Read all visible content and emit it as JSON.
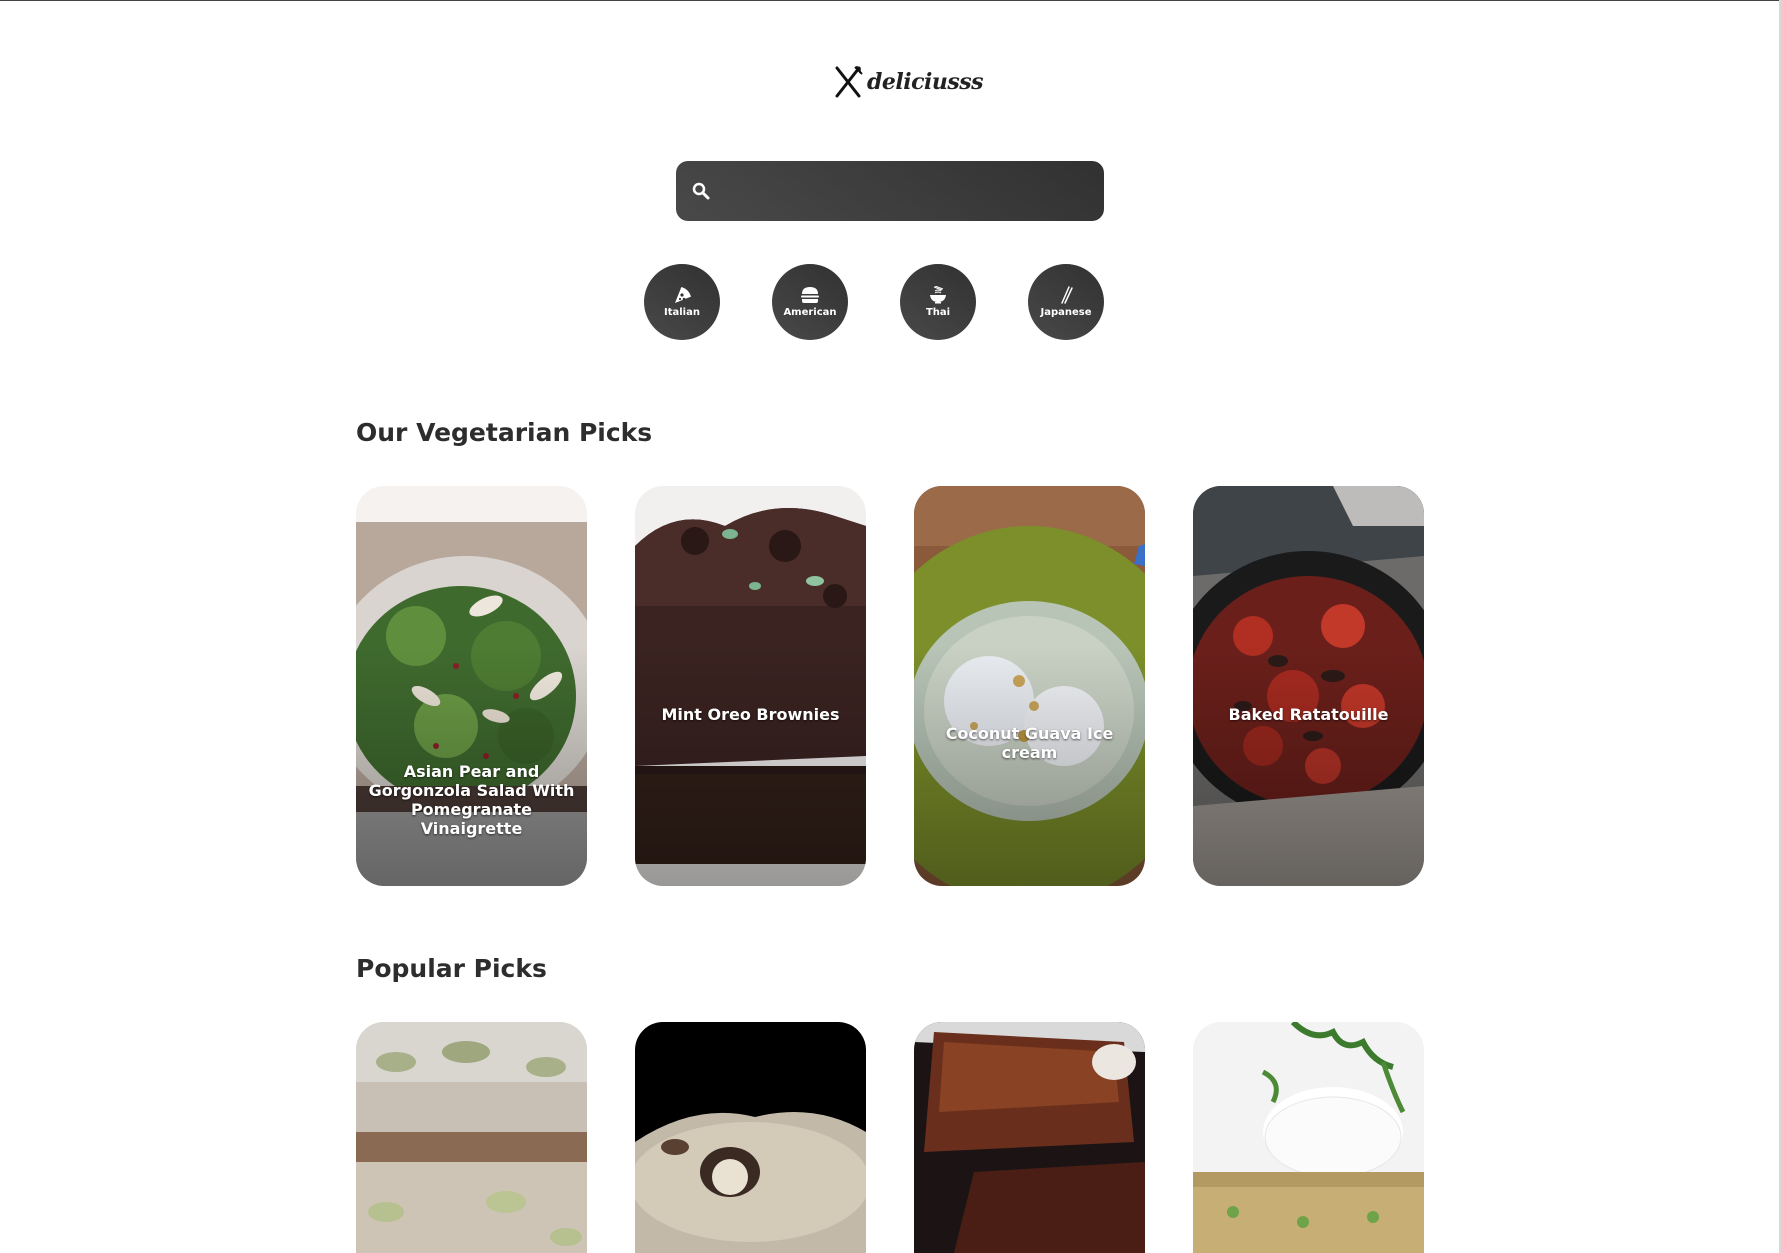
{
  "brand": {
    "name": "deliciusss"
  },
  "search": {
    "value": "",
    "placeholder": ""
  },
  "cuisines": [
    {
      "label": "Italian",
      "icon": "pizza-icon"
    },
    {
      "label": "American",
      "icon": "burger-icon"
    },
    {
      "label": "Thai",
      "icon": "noodle-bowl-icon"
    },
    {
      "label": "Japanese",
      "icon": "chopsticks-icon"
    }
  ],
  "sections": {
    "vegetarian": {
      "title": "Our Vegetarian Picks",
      "items": [
        {
          "title": "Asian Pear and Gorgonzola Salad With Pomegranate Vinaigrette"
        },
        {
          "title": "Mint Oreo Brownies"
        },
        {
          "title": "Coconut Guava Ice cream"
        },
        {
          "title": "Baked Ratatouille"
        }
      ]
    },
    "popular": {
      "title": "Popular Picks",
      "items": [
        {},
        {},
        {},
        {}
      ]
    }
  },
  "colors": {
    "accent_dark": "#313131",
    "accent_light": "#494949",
    "background": "#ffffff",
    "text": "#2d2d2d"
  }
}
